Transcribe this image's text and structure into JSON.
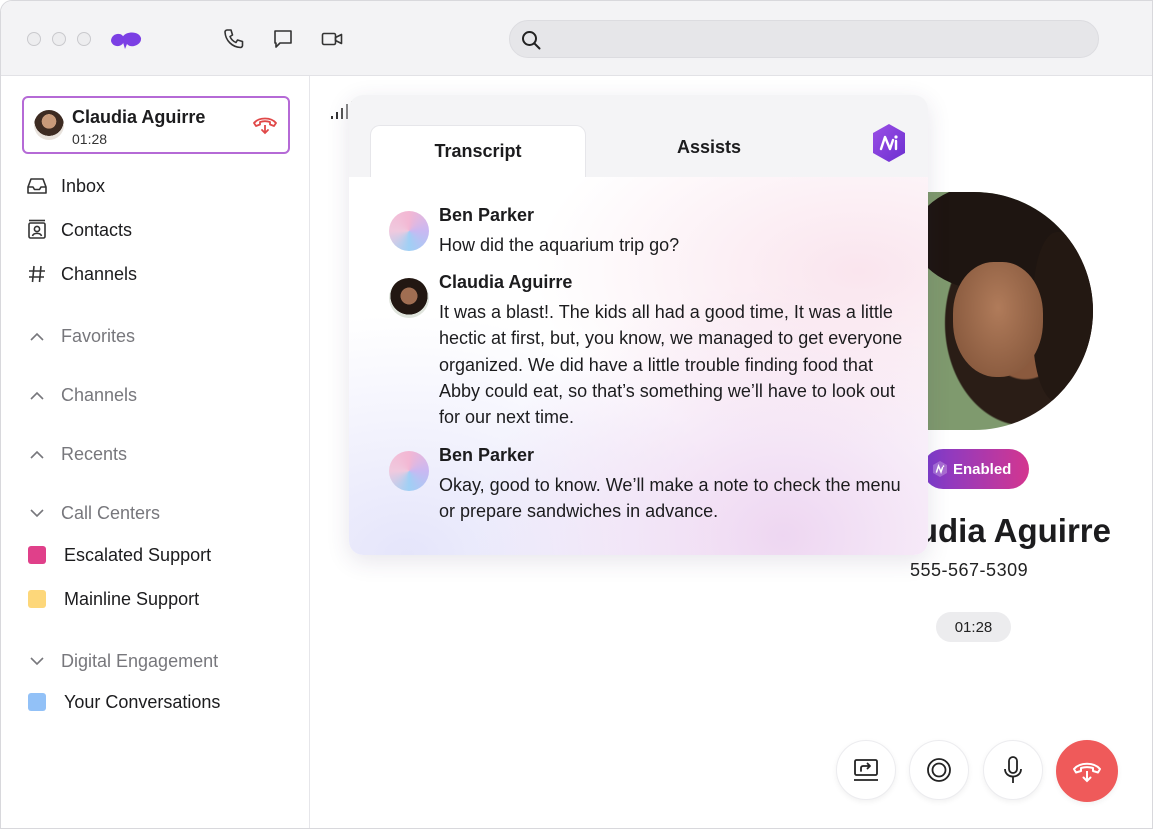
{
  "titlebar": {
    "search": {
      "value": "",
      "placeholder": ""
    }
  },
  "active_call": {
    "name": "Claudia Aguirre",
    "time": "01:28"
  },
  "nav": [
    {
      "label": "Inbox",
      "icon": "inbox-icon"
    },
    {
      "label": "Contacts",
      "icon": "contacts-icon"
    },
    {
      "label": "Channels",
      "icon": "hash-icon"
    }
  ],
  "sections": {
    "favorites": "Favorites",
    "channels": "Channels",
    "recents": "Recents",
    "call_centers": "Call Centers",
    "digital_engagement": "Digital Engagement"
  },
  "call_centers": [
    {
      "label": "Escalated Support",
      "color": "#e0408a"
    },
    {
      "label": "Mainline Support",
      "color": "#fdd77a"
    }
  ],
  "digital": [
    {
      "label": "Your Conversations",
      "color": "#92c1f7"
    }
  ],
  "transcript_card": {
    "tabs": {
      "transcript": "Transcript",
      "assists": "Assists"
    },
    "messages": [
      {
        "speaker": "Ben Parker",
        "text": "How did the aquarium trip go?"
      },
      {
        "speaker": "Claudia Aguirre",
        "text": "It was a blast!. The kids all had a good time, It was a little hectic at first, but, you know, we managed to get everyone organized. We did have a little trouble finding food that Abby could eat, so that’s something we’ll have to look out for our next time."
      },
      {
        "speaker": "Ben Parker",
        "text": "Okay, good to know. We’ll make a note to check the menu or prepare sandwiches in advance."
      }
    ]
  },
  "contact": {
    "name": "Claudia Aguirre",
    "phone": "555-567-5309",
    "badge": "Enabled",
    "timer": "01:28"
  },
  "colors": {
    "accent_purple": "#8b4fd9",
    "end_call_red": "#ef5a5a",
    "badge_gradient_start": "#7a3ccf",
    "badge_gradient_end": "#d4368f"
  }
}
